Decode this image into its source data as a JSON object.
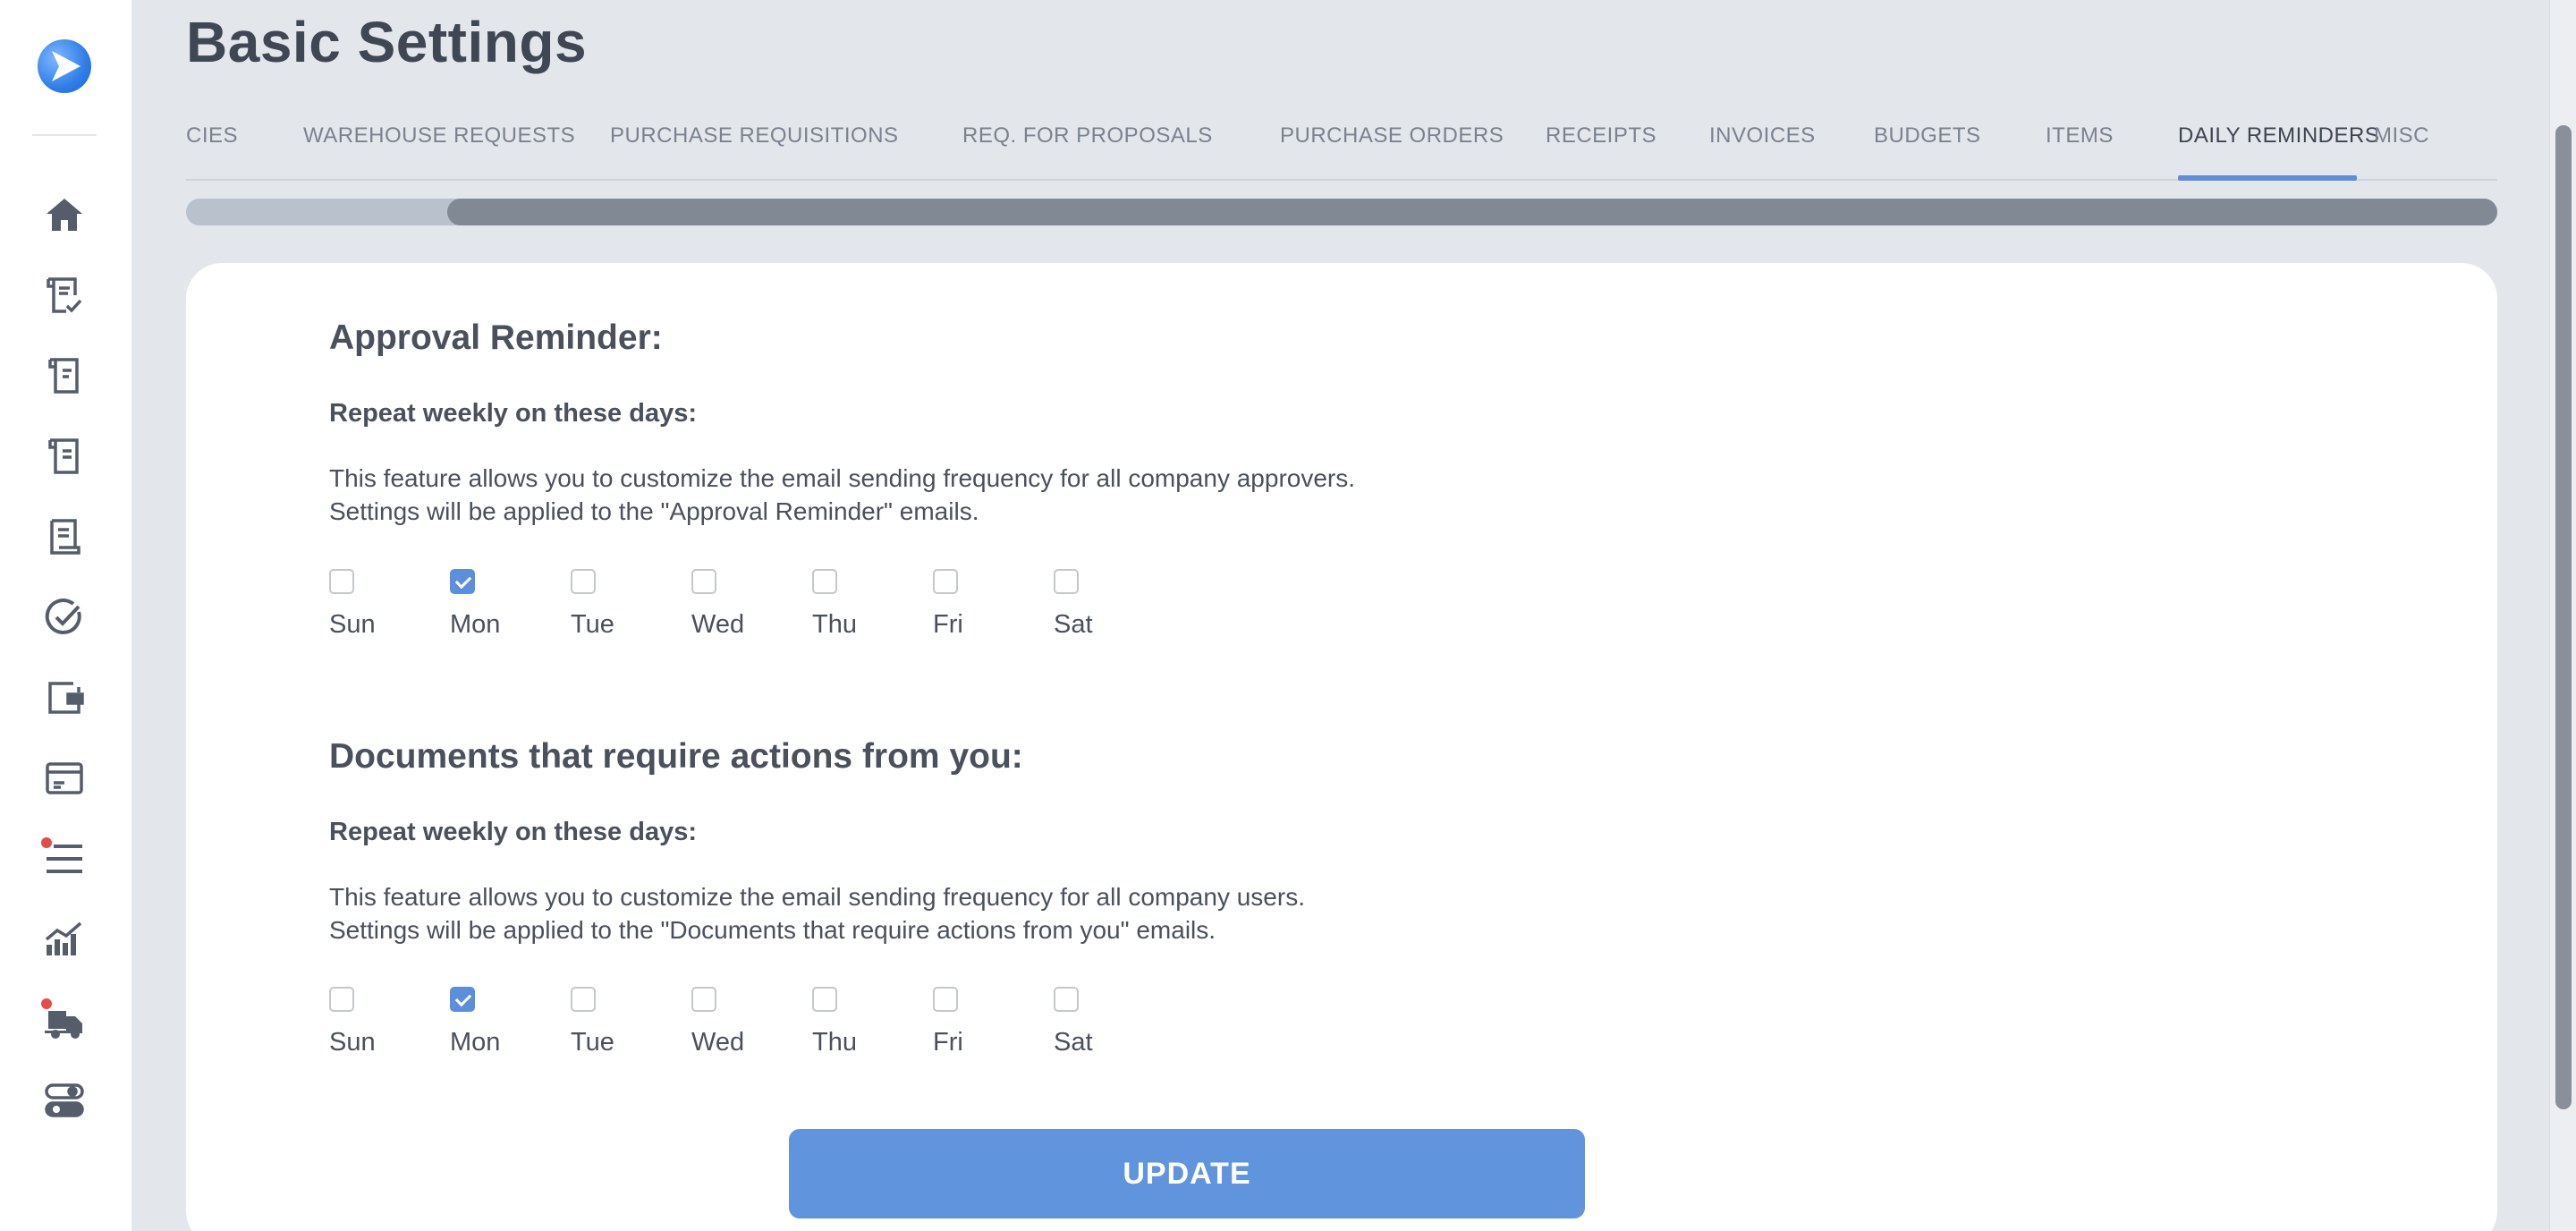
{
  "page": {
    "title": "Basic Settings"
  },
  "tabs": [
    {
      "label": "CIES"
    },
    {
      "label": "WAREHOUSE REQUESTS"
    },
    {
      "label": "PURCHASE REQUISITIONS"
    },
    {
      "label": "REQ. FOR PROPOSALS"
    },
    {
      "label": "PURCHASE ORDERS"
    },
    {
      "label": "RECEIPTS"
    },
    {
      "label": "INVOICES"
    },
    {
      "label": "BUDGETS"
    },
    {
      "label": "ITEMS"
    },
    {
      "label": "DAILY REMINDERS"
    },
    {
      "label": "MISC"
    }
  ],
  "active_tab": "DAILY REMINDERS",
  "sidebar": {
    "icons": [
      "home-icon",
      "requisition-check-icon",
      "document-icon",
      "document-alt-icon",
      "receipt-icon",
      "check-circle-icon",
      "wallet-icon",
      "card-icon",
      "list-icon",
      "chart-icon",
      "truck-icon",
      "toggle-icon"
    ]
  },
  "sections": [
    {
      "title": "Approval Reminder:",
      "subtitle": "Repeat weekly on these days:",
      "desc_line1": "This feature allows you to customize the email sending frequency for all company approvers.",
      "desc_line2": "Settings will be applied to the \"Approval Reminder\" emails.",
      "days": [
        {
          "label": "Sun",
          "checked": false
        },
        {
          "label": "Mon",
          "checked": true
        },
        {
          "label": "Tue",
          "checked": false
        },
        {
          "label": "Wed",
          "checked": false
        },
        {
          "label": "Thu",
          "checked": false
        },
        {
          "label": "Fri",
          "checked": false
        },
        {
          "label": "Sat",
          "checked": false
        }
      ]
    },
    {
      "title": "Documents that require actions from you:",
      "subtitle": "Repeat weekly on these days:",
      "desc_line1": "This feature allows you to customize the email sending frequency for all company users.",
      "desc_line2": "Settings will be applied to the \"Documents that require actions from you\" emails.",
      "days": [
        {
          "label": "Sun",
          "checked": false
        },
        {
          "label": "Mon",
          "checked": true
        },
        {
          "label": "Tue",
          "checked": false
        },
        {
          "label": "Wed",
          "checked": false
        },
        {
          "label": "Thu",
          "checked": false
        },
        {
          "label": "Fri",
          "checked": false
        },
        {
          "label": "Sat",
          "checked": false
        }
      ]
    }
  ],
  "update_label": "UPDATE",
  "colors": {
    "accent": "#5b8fdc",
    "button": "#6094dc",
    "background": "#e3e6eb",
    "notification_dot": "#e84a4a"
  }
}
